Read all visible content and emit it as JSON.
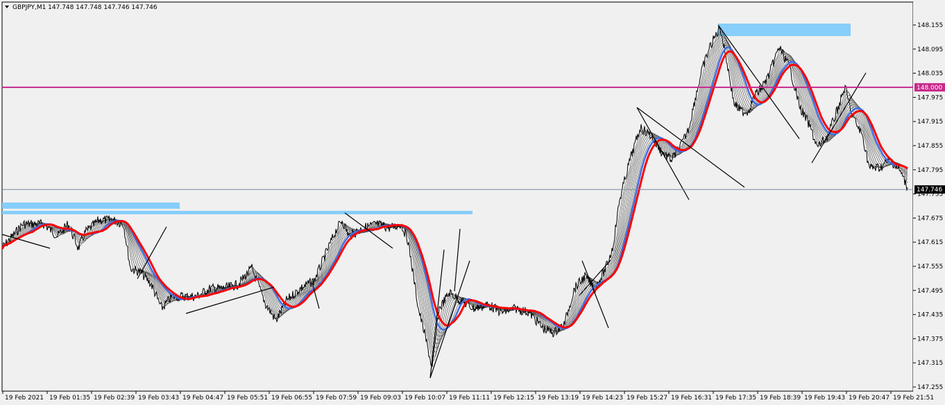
{
  "chart_data": {
    "type": "line",
    "symbol": "GBPJPY,M1",
    "title": "GBPJPY,M1  147.748 147.748 147.746 147.746",
    "ohlc": {
      "open": "147.748",
      "high": "147.748",
      "low": "147.746",
      "close": "147.746"
    },
    "ylim": [
      147.255,
      148.185
    ],
    "y_ticks": [
      "148.155",
      "148.095",
      "148.035",
      "147.975",
      "147.915",
      "147.855",
      "147.795",
      "147.735",
      "147.675",
      "147.615",
      "147.555",
      "147.495",
      "147.435",
      "147.375",
      "147.315",
      "147.255"
    ],
    "x_ticks": [
      "19 Feb 2021",
      "19 Feb 01:35",
      "19 Feb 02:39",
      "19 Feb 03:43",
      "19 Feb 04:47",
      "19 Feb 05:51",
      "19 Feb 06:55",
      "19 Feb 07:59",
      "19 Feb 09:03",
      "19 Feb 10:07",
      "19 Feb 11:11",
      "19 Feb 12:15",
      "19 Feb 13:19",
      "19 Feb 14:23",
      "19 Feb 15:27",
      "19 Feb 16:31",
      "19 Feb 17:35",
      "19 Feb 18:39",
      "19 Feb 19:43",
      "19 Feb 20:47",
      "19 Feb 21:51"
    ],
    "price_series": {
      "name": "",
      "x": [
        0,
        30,
        60,
        80,
        95,
        110,
        120,
        140,
        160,
        175,
        185,
        200,
        215,
        230,
        245,
        260,
        280,
        300,
        320,
        340,
        360,
        380,
        395,
        410,
        430,
        450,
        470,
        480,
        490,
        500,
        520,
        540,
        560,
        575,
        585,
        600,
        610,
        620,
        630,
        645,
        660,
        680,
        700,
        720,
        740,
        760,
        780,
        795,
        810,
        825,
        840,
        855,
        870,
        880,
        890,
        905,
        920,
        935,
        950,
        965,
        980,
        990,
        1000,
        1010,
        1020,
        1035,
        1045,
        1055,
        1065,
        1075,
        1085,
        1095,
        1105,
        1120,
        1135,
        1150,
        1165,
        1175,
        1190,
        1205,
        1215,
        1225,
        1240,
        1250,
        1265,
        1280,
        1295,
        1305
      ],
      "values": [
        147.6,
        147.66,
        147.66,
        147.63,
        147.66,
        147.6,
        147.64,
        147.67,
        147.67,
        147.66,
        147.55,
        147.54,
        147.51,
        147.45,
        147.48,
        147.48,
        147.48,
        147.5,
        147.5,
        147.51,
        147.55,
        147.46,
        147.42,
        147.47,
        147.5,
        147.52,
        147.6,
        147.64,
        147.67,
        147.63,
        147.65,
        147.66,
        147.65,
        147.66,
        147.62,
        147.45,
        147.38,
        147.3,
        147.45,
        147.49,
        147.47,
        147.45,
        147.46,
        147.44,
        147.45,
        147.44,
        147.4,
        147.39,
        147.41,
        147.5,
        147.53,
        147.5,
        147.55,
        147.6,
        147.72,
        147.82,
        147.9,
        147.88,
        147.84,
        147.82,
        147.86,
        147.9,
        147.98,
        148.05,
        148.1,
        148.15,
        148.06,
        147.96,
        147.94,
        147.94,
        147.98,
        148.0,
        148.03,
        148.1,
        148.05,
        147.95,
        147.9,
        147.85,
        147.88,
        147.95,
        148.0,
        147.93,
        147.88,
        147.8,
        147.8,
        147.82,
        147.79,
        147.75
      ]
    },
    "current_price": "147.746",
    "horizontal_level": {
      "value": 148.0,
      "label": "148.000",
      "color": "#c8288c"
    },
    "ma_color": "#ff0000",
    "ma_blue_color": "#3c6ee6",
    "zone_color": "#87cefa",
    "price_line_color": "#000000"
  }
}
